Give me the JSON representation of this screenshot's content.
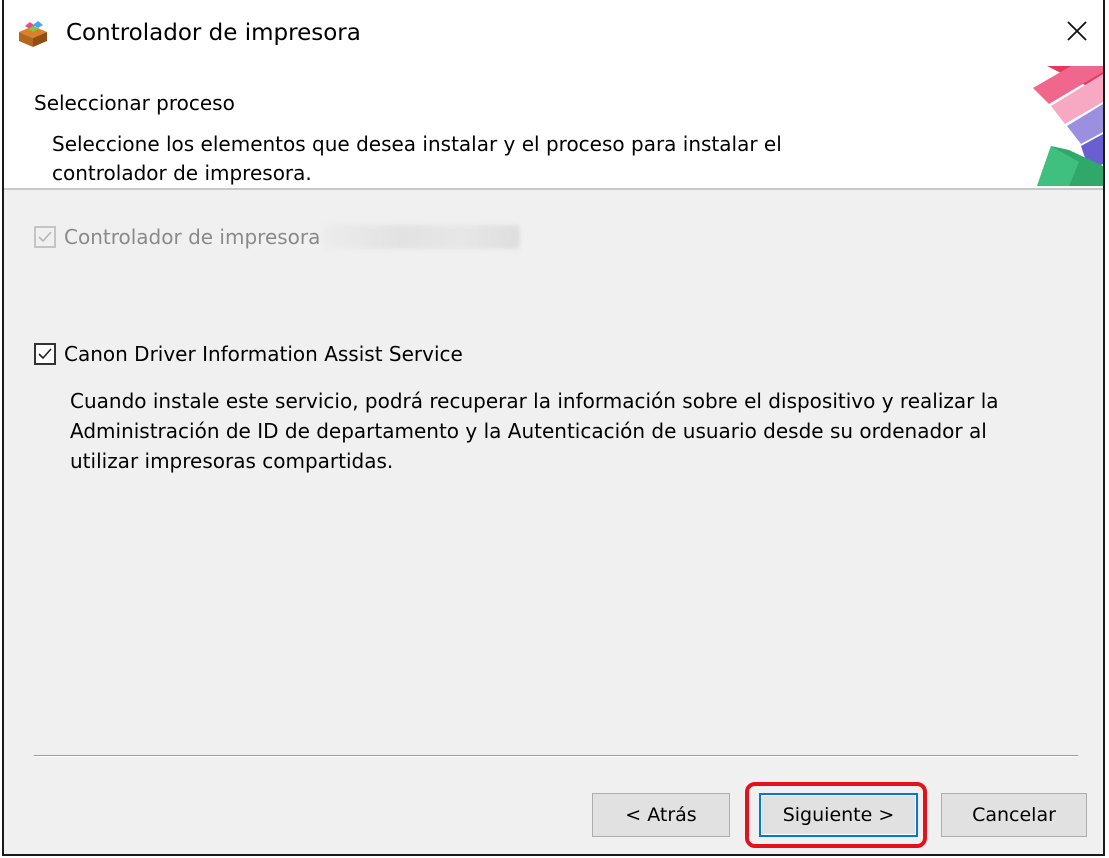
{
  "window": {
    "title": "Controlador de impresora",
    "icon": "printer-driver-package-icon",
    "close_icon": "close-icon"
  },
  "header": {
    "title": "Seleccionar proceso",
    "description": "Seleccione los elementos que desea instalar y el proceso para instalar el controlador de impresora."
  },
  "options": {
    "driver": {
      "label": "Controlador de impresora",
      "checked": true,
      "enabled": false
    },
    "assist_service": {
      "label": "Canon Driver Information Assist Service",
      "checked": true,
      "enabled": true,
      "description": "Cuando instale este servicio, podrá recuperar la información sobre el dispositivo y realizar la Administración de ID de departamento y la Autenticación de usuario desde su ordenador al utilizar impresoras compartidas."
    }
  },
  "buttons": {
    "back": "< Atrás",
    "next": "Siguiente >",
    "cancel": "Cancelar"
  },
  "colors": {
    "highlight": "#e3101e",
    "default_button_border": "#0078d7",
    "dialog_background": "#f0f0f0"
  }
}
